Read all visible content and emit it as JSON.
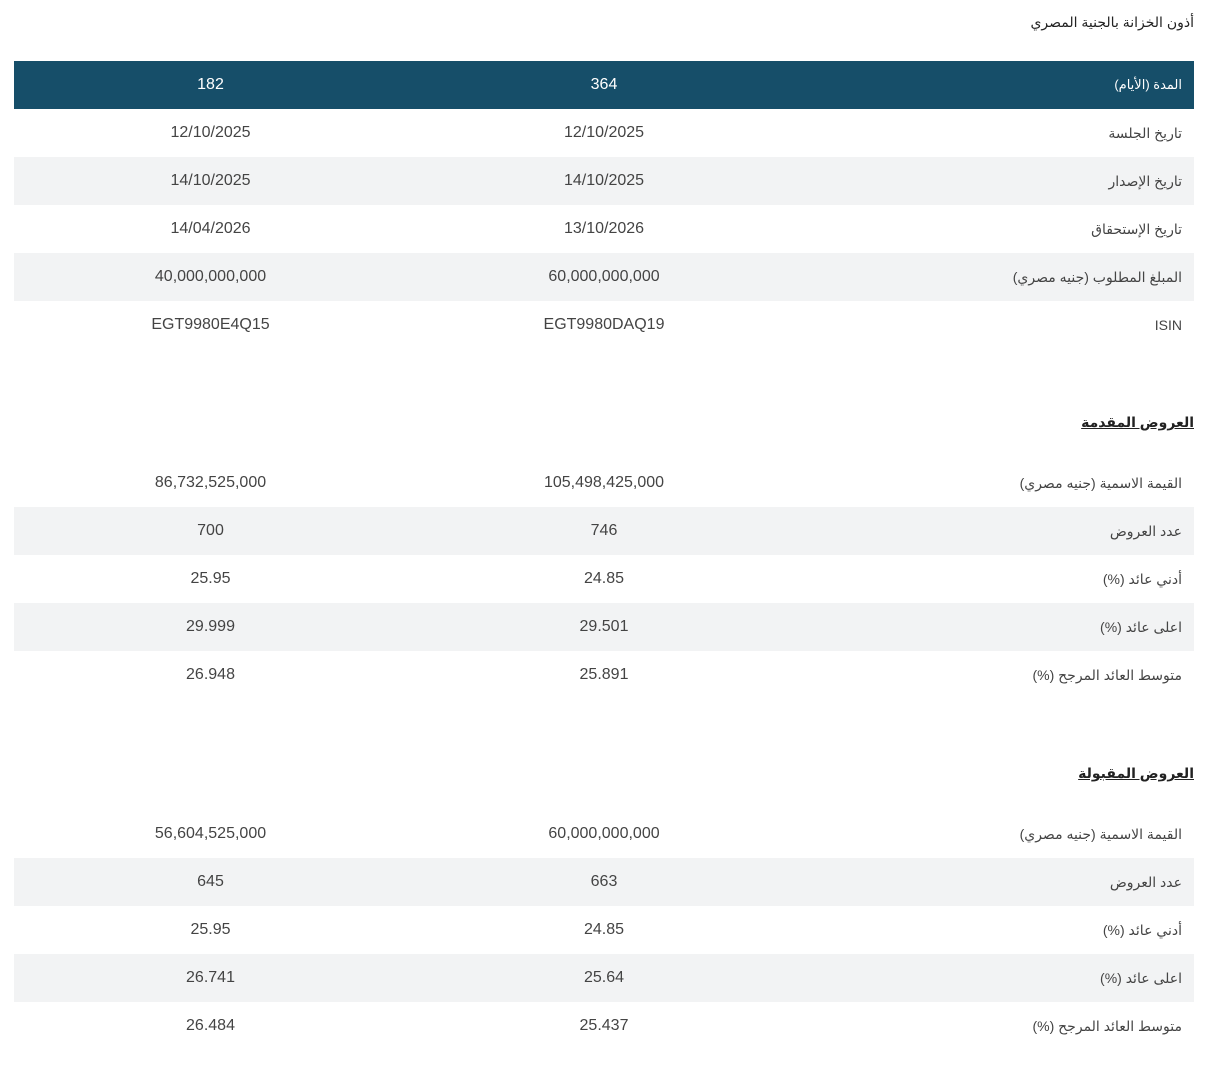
{
  "title": "أذون الخزانة بالجنية المصري",
  "main_table": {
    "header": {
      "label": "المدة (الأيام)",
      "col364": "364",
      "col182": "182"
    },
    "rows": [
      {
        "label": "تاريخ الجلسة",
        "col364": "12/10/2025",
        "col182": "12/10/2025"
      },
      {
        "label": "تاريخ الإصدار",
        "col364": "14/10/2025",
        "col182": "14/10/2025"
      },
      {
        "label": "تاريخ الإستحقاق",
        "col364": "13/10/2026",
        "col182": "14/04/2026"
      },
      {
        "label": "المبلغ المطلوب (جنيه مصري)",
        "col364": "60,000,000,000",
        "col182": "40,000,000,000"
      },
      {
        "label": "ISIN",
        "col364": "EGT9980DAQ19",
        "col182": "EGT9980E4Q15"
      }
    ]
  },
  "offers_submitted": {
    "title": "العروض المقدمة",
    "rows": [
      {
        "label": "القيمة الاسمية (جنيه مصري)",
        "col364": "105,498,425,000",
        "col182": "86,732,525,000"
      },
      {
        "label": "عدد العروض",
        "col364": "746",
        "col182": "700"
      },
      {
        "label": "أدني عائد (%)",
        "col364": "24.85",
        "col182": "25.95"
      },
      {
        "label": "اعلى عائد (%)",
        "col364": "29.501",
        "col182": "29.999"
      },
      {
        "label": "متوسط العائد المرجح (%)",
        "col364": "25.891",
        "col182": "26.948"
      }
    ]
  },
  "offers_accepted": {
    "title": "العروض المقبولة",
    "rows": [
      {
        "label": "القيمة الاسمية (جنيه مصري)",
        "col364": "60,000,000,000",
        "col182": "56,604,525,000"
      },
      {
        "label": "عدد العروض",
        "col364": "663",
        "col182": "645"
      },
      {
        "label": "أدني عائد (%)",
        "col364": "24.85",
        "col182": "25.95"
      },
      {
        "label": "اعلى عائد (%)",
        "col364": "25.64",
        "col182": "26.741"
      },
      {
        "label": "متوسط العائد المرجح (%)",
        "col364": "25.437",
        "col182": "26.484"
      }
    ]
  },
  "colors": {
    "header_bg": "#164e69",
    "alt_row_bg": "#f2f3f4"
  }
}
